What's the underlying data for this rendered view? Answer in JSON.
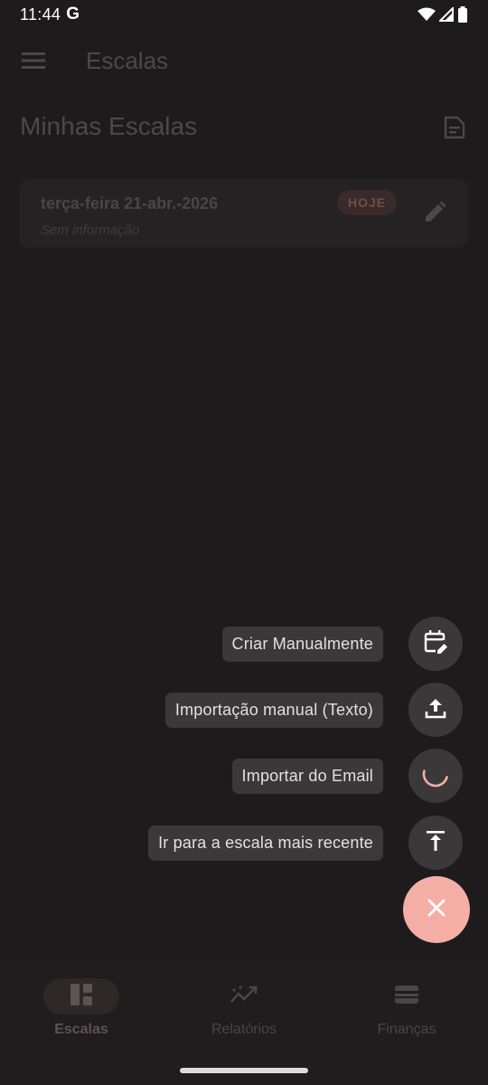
{
  "status_bar": {
    "time": "11:44",
    "g_logo": "G",
    "icons": [
      "wifi-icon",
      "signal-icon",
      "battery-icon"
    ]
  },
  "app_bar": {
    "title": "Escalas",
    "menu_icon": "menu-icon"
  },
  "section": {
    "title": "Minhas Escalas",
    "action_icon": "document-icon"
  },
  "schedule_card": {
    "date": "terça-feira 21-abr.-2026",
    "info": "Sem informação",
    "badge": "HOJE",
    "edit_icon": "pencil-icon"
  },
  "fab_menu": {
    "items": [
      {
        "label": "Criar Manualmente",
        "icon": "calendar-edit-icon"
      },
      {
        "label": "Importação manual (Texto)",
        "icon": "upload-icon"
      },
      {
        "label": "Importar do Email",
        "icon": "loading-spinner-icon"
      },
      {
        "label": "Ir para a escala mais recente",
        "icon": "scroll-to-top-icon"
      }
    ],
    "main_icon": "close-icon"
  },
  "bottom_nav": {
    "items": [
      {
        "label": "Escalas",
        "icon": "dashboard-icon",
        "active": true
      },
      {
        "label": "Relatórios",
        "icon": "trending-icon",
        "active": false
      },
      {
        "label": "Finanças",
        "icon": "wallet-icon",
        "active": false
      }
    ]
  },
  "colors": {
    "background": "#1d1b1c",
    "fab_main": "#f5aea6",
    "fab_mini": "#3b3839",
    "accent_spinner": "#f5aea6"
  }
}
